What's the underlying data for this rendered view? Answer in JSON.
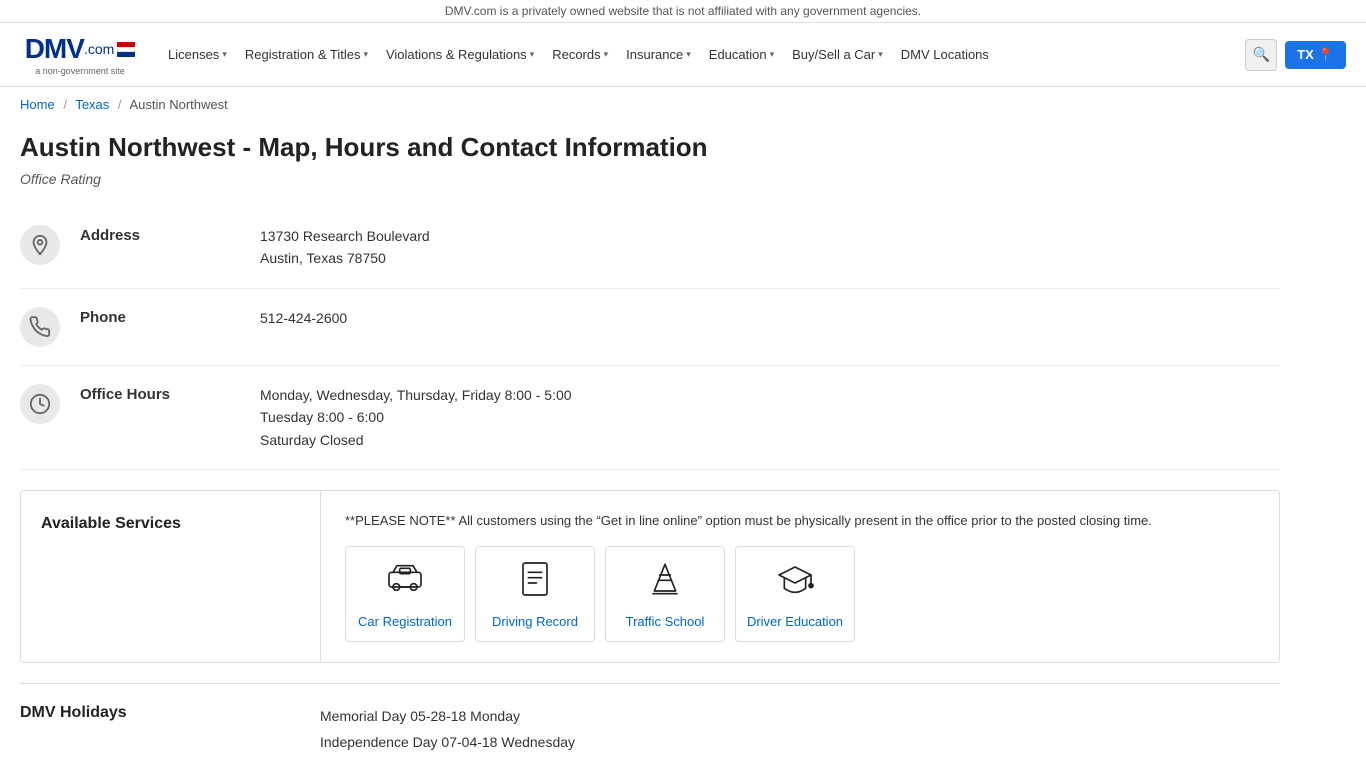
{
  "topbar": {
    "notice": "DMV.com is a privately owned website that is not affiliated with any government agencies."
  },
  "nav": {
    "logo": {
      "main": "DMV",
      "sub": "a non-government site"
    },
    "links": [
      {
        "label": "Licenses",
        "has_dropdown": true
      },
      {
        "label": "Registration & Titles",
        "has_dropdown": true
      },
      {
        "label": "Violations & Regulations",
        "has_dropdown": true
      },
      {
        "label": "Records",
        "has_dropdown": true
      },
      {
        "label": "Insurance",
        "has_dropdown": true
      },
      {
        "label": "Education",
        "has_dropdown": true
      },
      {
        "label": "Buy/Sell a Car",
        "has_dropdown": true
      },
      {
        "label": "DMV Locations",
        "has_dropdown": false
      }
    ],
    "state_btn": "TX",
    "search_icon": "🔍"
  },
  "breadcrumb": {
    "items": [
      {
        "label": "Home",
        "href": "#"
      },
      {
        "label": "Texas",
        "href": "#"
      },
      {
        "label": "Austin Northwest",
        "href": null
      }
    ]
  },
  "page": {
    "title": "Austin Northwest - Map, Hours and Contact Information",
    "office_rating_label": "Office Rating"
  },
  "address": {
    "label": "Address",
    "line1": "13730 Research Boulevard",
    "line2": "Austin, Texas 78750"
  },
  "phone": {
    "label": "Phone",
    "value": "512-424-2600"
  },
  "hours": {
    "label": "Office Hours",
    "line1": "Monday, Wednesday, Thursday, Friday 8:00 - 5:00",
    "line2": "Tuesday 8:00 - 6:00",
    "line3": "Saturday Closed"
  },
  "services": {
    "heading": "Available Services",
    "note": "**PLEASE NOTE** All customers using the “Get in line online” option must be physically present in the office prior to the posted closing time.",
    "items": [
      {
        "label": "Car Registration",
        "icon": "car-reg"
      },
      {
        "label": "Driving Record",
        "icon": "doc"
      },
      {
        "label": "Traffic School",
        "icon": "cone"
      },
      {
        "label": "Driver Education",
        "icon": "grad"
      }
    ]
  },
  "holidays": {
    "heading": "DMV Holidays",
    "items": [
      "Memorial Day 05-28-18 Monday",
      "Independence Day 07-04-18 Wednesday"
    ]
  }
}
